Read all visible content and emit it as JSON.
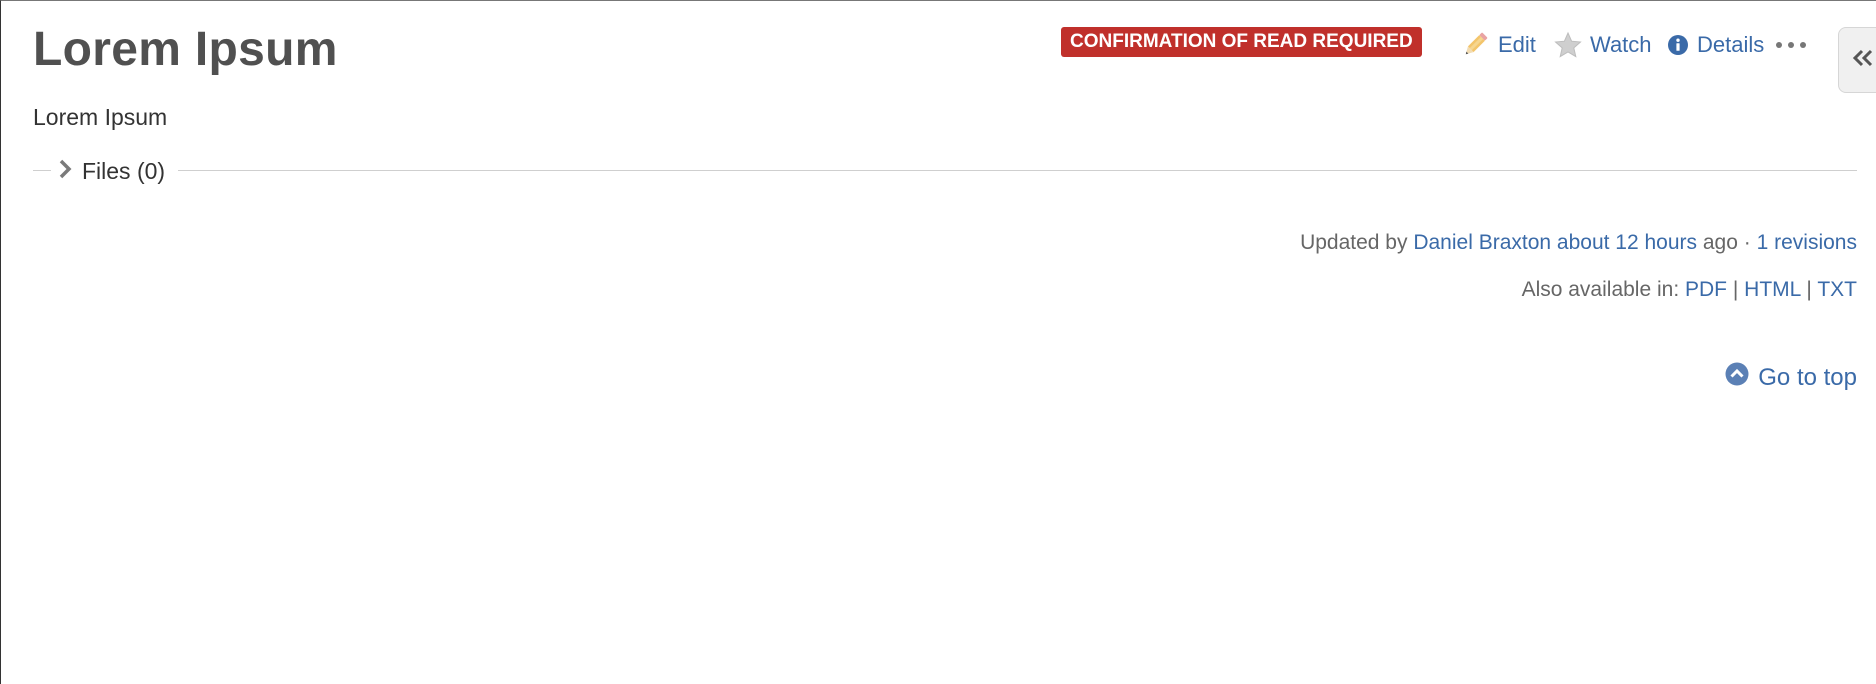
{
  "page": {
    "title": "Lorem Ipsum",
    "description": "Lorem Ipsum"
  },
  "header": {
    "badge": "CONFIRMATION OF READ REQUIRED",
    "edit_label": "Edit",
    "watch_label": "Watch",
    "details_label": "Details",
    "more_icon": "ellipsis-icon",
    "sidebar_toggle_icon": "double-chevron-left-icon"
  },
  "files": {
    "label": "Files (0)",
    "expanded": false
  },
  "meta": {
    "updated_by_prefix": "Updated by",
    "author": "Daniel Braxton",
    "time_ago": "about 12 hours",
    "ago_suffix": "ago",
    "separator": "·",
    "revisions": "1 revisions",
    "also_available_label": "Also available in:",
    "formats": [
      "PDF",
      "HTML",
      "TXT"
    ],
    "format_separator": "|"
  },
  "footer": {
    "go_top_label": "Go to top"
  },
  "colors": {
    "link": "#3a6aa8",
    "badge": "#c0302b",
    "title": "#505050",
    "muted": "#666666"
  }
}
